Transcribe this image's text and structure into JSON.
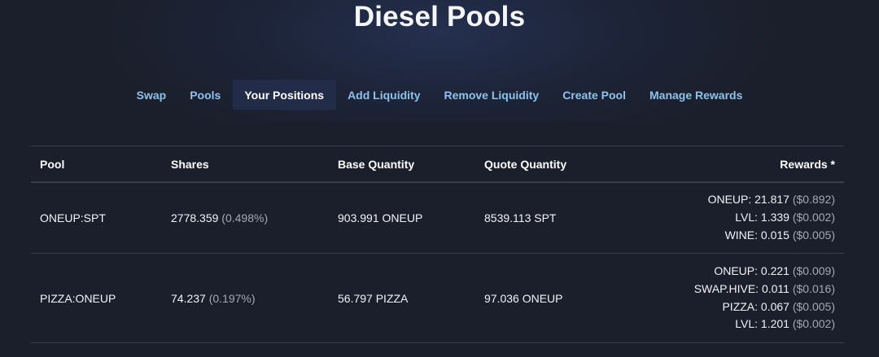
{
  "header": {
    "title": "Diesel Pools"
  },
  "nav": {
    "tabs": [
      {
        "label": "Swap"
      },
      {
        "label": "Pools"
      },
      {
        "label": "Your Positions"
      },
      {
        "label": "Add Liquidity"
      },
      {
        "label": "Remove Liquidity"
      },
      {
        "label": "Create Pool"
      },
      {
        "label": "Manage Rewards"
      }
    ],
    "active": "Your Positions"
  },
  "table": {
    "columns": [
      "Pool",
      "Shares",
      "Base Quantity",
      "Quote Quantity",
      "Rewards *"
    ],
    "rows": [
      {
        "pool": "ONEUP:SPT",
        "shares": "2778.359",
        "shares_pct": "(0.498%)",
        "base": "903.991 ONEUP",
        "quote": "8539.113 SPT",
        "rewards": [
          {
            "amount": "ONEUP: 21.817",
            "usd": "($0.892)"
          },
          {
            "amount": "LVL: 1.339",
            "usd": "($0.002)"
          },
          {
            "amount": "WINE: 0.015",
            "usd": "($0.005)"
          }
        ]
      },
      {
        "pool": "PIZZA:ONEUP",
        "shares": "74.237",
        "shares_pct": "(0.197%)",
        "base": "56.797 PIZZA",
        "quote": "97.036 ONEUP",
        "rewards": [
          {
            "amount": "ONEUP: 0.221",
            "usd": "($0.009)"
          },
          {
            "amount": "SWAP.HIVE: 0.011",
            "usd": "($0.016)"
          },
          {
            "amount": "PIZZA: 0.067",
            "usd": "($0.005)"
          },
          {
            "amount": "LVL: 1.201",
            "usd": "($0.002)"
          }
        ]
      }
    ]
  },
  "colors": {
    "background": "#1b1f2b",
    "nav_link": "#8cc3ec",
    "nav_active_bg": "#222c48",
    "muted_text": "#a3a8b4",
    "divider": "#3a3f4c"
  }
}
